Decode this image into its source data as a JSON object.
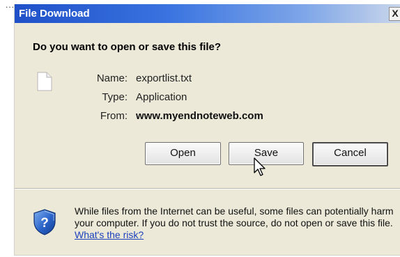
{
  "dialog": {
    "title": "File Download",
    "close_glyph": "X",
    "question": "Do you want to open or save this file?",
    "file_icon": "document-icon",
    "info": {
      "name_label": "Name:",
      "name_value": "exportlist.txt",
      "type_label": "Type:",
      "type_value": "Application",
      "from_label": "From:",
      "from_value": "www.myendnoteweb.com"
    },
    "buttons": {
      "open": "Open",
      "save": "Save",
      "cancel": "Cancel"
    },
    "warning": {
      "icon": "shield-question-icon",
      "text": "While files from the Internet can be useful, some files can potentially harm your computer. If you do not trust the source, do not open or save this file.",
      "link": "What's the risk?"
    }
  },
  "decor": {
    "corner_dots": "...",
    "cursor_icon": "mouse-pointer-icon"
  }
}
